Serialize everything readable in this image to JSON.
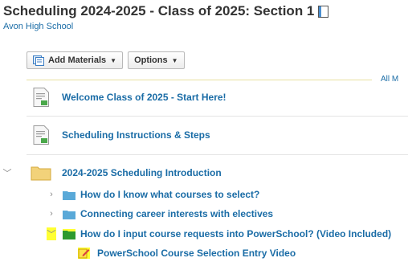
{
  "course": {
    "title": "Scheduling 2024-2025 - Class of 2025: Section 1",
    "school": "Avon High School"
  },
  "toolbar": {
    "add_materials_label": "Add Materials",
    "options_label": "Options",
    "all_materials_label": "All M"
  },
  "materials": [
    {
      "label": "Welcome Class of 2025 - Start Here!",
      "icon": "page-icon"
    },
    {
      "label": "Scheduling Instructions & Steps",
      "icon": "page-icon"
    }
  ],
  "folder": {
    "label": "2024-2025 Scheduling Introduction",
    "icon": "folder-icon",
    "expanded": true,
    "children": [
      {
        "label": "How do I know what courses to select?",
        "expanded": false,
        "highlighted": false
      },
      {
        "label": "Connecting career interests with electives",
        "expanded": false,
        "highlighted": false
      },
      {
        "label": "How do I input course requests into PowerSchool? (Video Included)",
        "expanded": true,
        "highlighted": true,
        "children": [
          {
            "label": "PowerSchool Course Selection Entry Video",
            "icon": "video-link-icon"
          }
        ]
      }
    ]
  },
  "colors": {
    "link": "#1a6ca6",
    "folder": "#f2d27a",
    "subfolder": "#5aa9d8",
    "highlight": "#ffff33",
    "highlighted_folder": "#2e9a2e"
  }
}
